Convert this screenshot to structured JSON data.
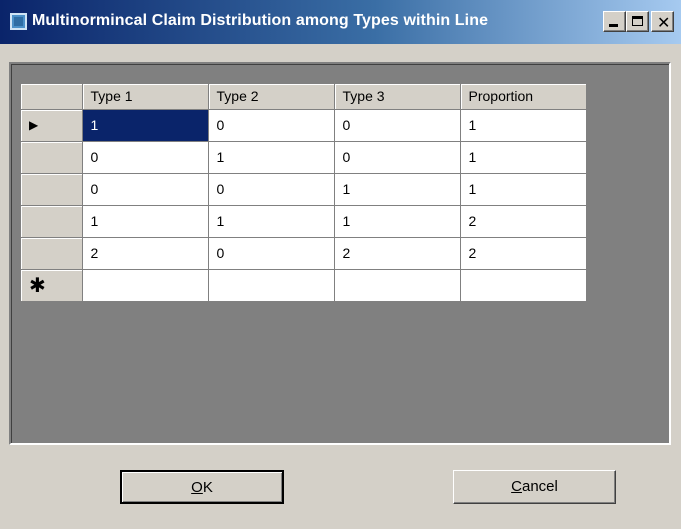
{
  "window": {
    "title": "Multinormincal Claim Distribution among Types within Line"
  },
  "grid": {
    "columns": [
      "Type 1",
      "Type 2",
      "Type 3",
      "Proportion"
    ],
    "rows": [
      [
        "1",
        "0",
        "0",
        "1"
      ],
      [
        "0",
        "1",
        "0",
        "1"
      ],
      [
        "0",
        "0",
        "1",
        "1"
      ],
      [
        "1",
        "1",
        "1",
        "2"
      ],
      [
        "2",
        "0",
        "2",
        "2"
      ]
    ],
    "current_row_marker": "▶",
    "new_row_marker": "✱",
    "selected_cell": {
      "row": 0,
      "col": 0
    }
  },
  "buttons": {
    "ok": {
      "mnemonic": "O",
      "rest": "K"
    },
    "cancel": {
      "mnemonic": "C",
      "rest": "ancel"
    }
  },
  "colors": {
    "title_gradient_start": "#0a246a",
    "title_gradient_end": "#a6caf0",
    "selection": "#0a246a",
    "grid_background": "#808080",
    "face": "#d4d0c8"
  },
  "icons": [
    "app-icon",
    "minimize-icon",
    "maximize-icon",
    "close-icon",
    "current-row-arrow-icon",
    "new-row-star-icon"
  ]
}
